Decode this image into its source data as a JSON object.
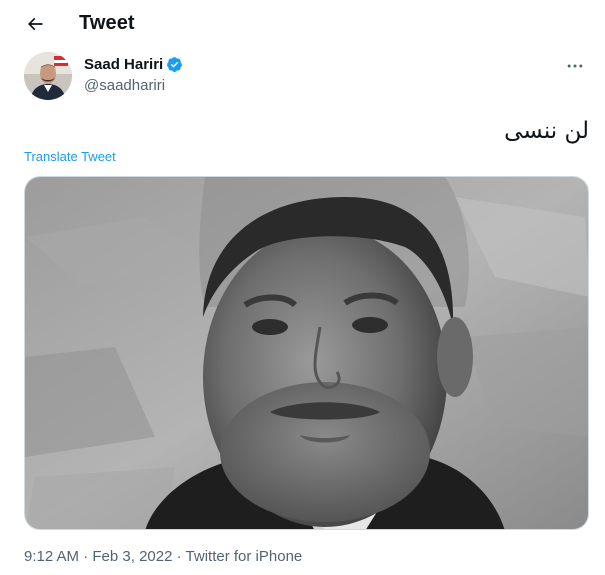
{
  "header": {
    "title": "Tweet",
    "back_icon": "arrow-left-icon"
  },
  "author": {
    "name": "Saad Hariri",
    "handle": "@saadhariri",
    "verified": true,
    "verified_color": "#1d9bf0"
  },
  "tweet": {
    "text": "لن ننسى",
    "translate_label": "Translate Tweet",
    "media_alt": "",
    "time": "9:12 AM",
    "separator": "·",
    "date": "Feb 3, 2022",
    "source": "Twitter for iPhone"
  },
  "colors": {
    "accent": "#1d9bf0",
    "secondary_text": "#536471",
    "primary_text": "#0f1419"
  }
}
